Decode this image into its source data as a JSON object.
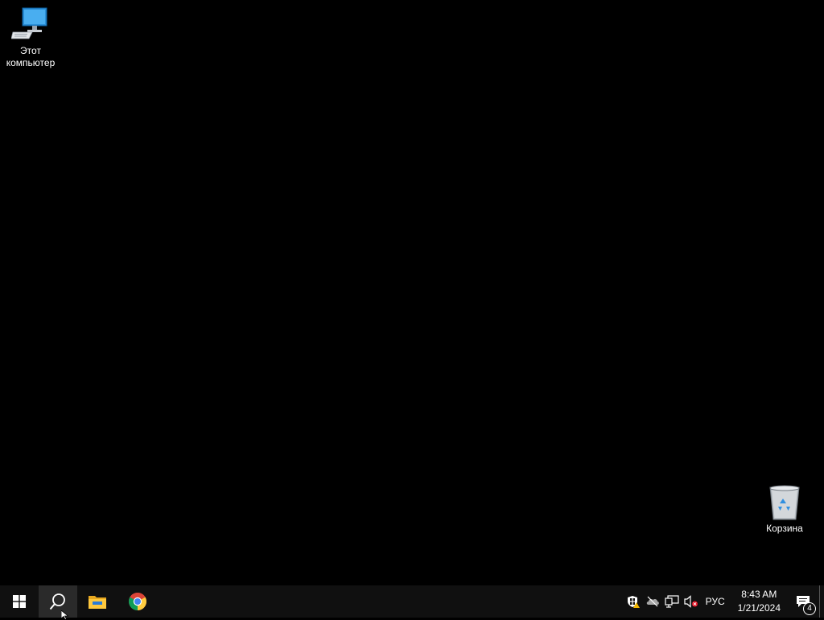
{
  "desktop": {
    "icons": [
      {
        "label": "Этот компьютер",
        "icon": "this-pc-icon"
      },
      {
        "label": "Корзина",
        "icon": "recycle-bin-icon"
      }
    ]
  },
  "taskbar": {
    "start": {
      "icon": "windows-logo-icon"
    },
    "search": {
      "icon": "search-icon"
    },
    "pinned": [
      {
        "icon": "file-explorer-icon"
      },
      {
        "icon": "chrome-icon"
      }
    ],
    "tray": {
      "icons": [
        "defender-warning-icon",
        "onedrive-offline-icon",
        "network-icon",
        "volume-muted-icon"
      ],
      "language": "РУС",
      "time": "8:43 AM",
      "date": "1/21/2024",
      "notification_count": "4"
    }
  },
  "colors": {
    "desktop_bg": "#000000",
    "taskbar_bg": "#101010",
    "active_button": "#2a2a2a"
  }
}
